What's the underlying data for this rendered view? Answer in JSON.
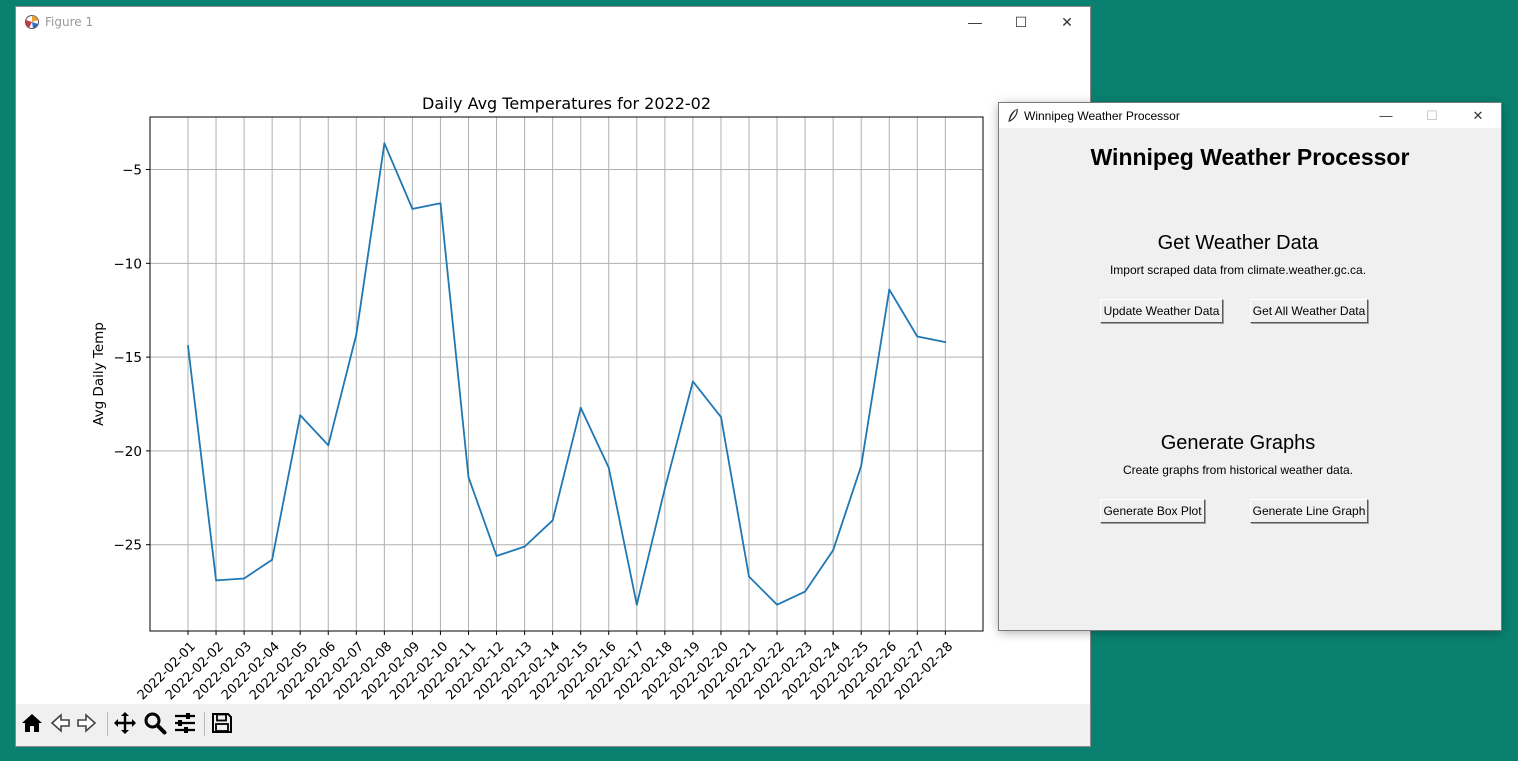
{
  "figure_window": {
    "title": "Figure 1",
    "controls": {
      "minimize": "—",
      "maximize": "☐",
      "close": "✕"
    }
  },
  "toolbar": {
    "buttons": [
      "home-icon",
      "back-icon",
      "forward-icon",
      "pan-icon",
      "zoom-icon",
      "configure-subplots-icon",
      "save-icon"
    ]
  },
  "chart_data": {
    "type": "line",
    "title": "Daily Avg Temperatures for 2022-02",
    "xlabel": "",
    "ylabel": "Avg Daily Temp",
    "grid": true,
    "ylim": [
      -29.6,
      -2.2
    ],
    "yticks": [
      -5,
      -10,
      -15,
      -20,
      -25
    ],
    "ytick_labels": [
      "−5",
      "−10",
      "−15",
      "−20",
      "−25"
    ],
    "line_color": "#1f77b4",
    "categories": [
      "2022-02-01",
      "2022-02-02",
      "2022-02-03",
      "2022-02-04",
      "2022-02-05",
      "2022-02-06",
      "2022-02-07",
      "2022-02-08",
      "2022-02-09",
      "2022-02-10",
      "2022-02-11",
      "2022-02-12",
      "2022-02-13",
      "2022-02-14",
      "2022-02-15",
      "2022-02-16",
      "2022-02-17",
      "2022-02-18",
      "2022-02-19",
      "2022-02-20",
      "2022-02-21",
      "2022-02-22",
      "2022-02-23",
      "2022-02-24",
      "2022-02-25",
      "2022-02-26",
      "2022-02-27",
      "2022-02-28"
    ],
    "values": [
      -14.4,
      -26.9,
      -26.8,
      -25.8,
      -18.1,
      -19.7,
      -13.8,
      -3.6,
      -7.1,
      -6.8,
      -21.4,
      -25.6,
      -25.1,
      -23.7,
      -17.7,
      -20.9,
      -28.2,
      -22.0,
      -16.3,
      -18.2,
      -26.7,
      -28.2,
      -27.5,
      -25.3,
      -20.8,
      -11.4,
      -13.9,
      -14.2
    ]
  },
  "app_window": {
    "title": "Winnipeg Weather Processor",
    "controls": {
      "minimize": "—",
      "maximize": "☐",
      "close": "✕"
    },
    "heading": "Winnipeg Weather Processor",
    "get_data": {
      "heading": "Get Weather Data",
      "description": "Import scraped data from climate.weather.gc.ca.",
      "update_button": "Update Weather Data",
      "get_all_button": "Get All Weather Data"
    },
    "graphs": {
      "heading": "Generate Graphs",
      "description": "Create graphs from historical weather data.",
      "box_plot_button": "Generate Box Plot",
      "line_graph_button": "Generate Line Graph"
    }
  }
}
